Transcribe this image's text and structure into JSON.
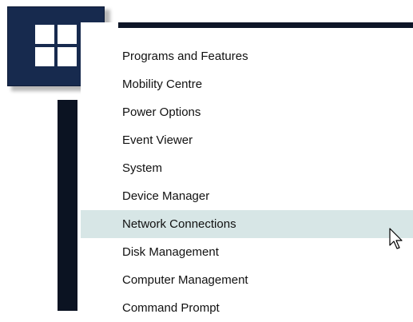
{
  "start_button": {
    "icon": "windows-logo-icon",
    "color": "#172a4e"
  },
  "menu": {
    "highlight_color": "#d7e6e6",
    "items": [
      {
        "label": "Programs and Features",
        "highlighted": false
      },
      {
        "label": "Mobility Centre",
        "highlighted": false
      },
      {
        "label": "Power Options",
        "highlighted": false
      },
      {
        "label": "Event Viewer",
        "highlighted": false
      },
      {
        "label": "System",
        "highlighted": false
      },
      {
        "label": "Device Manager",
        "highlighted": false
      },
      {
        "label": "Network Connections",
        "highlighted": true
      },
      {
        "label": "Disk Management",
        "highlighted": false
      },
      {
        "label": "Computer Management",
        "highlighted": false
      },
      {
        "label": "Command Prompt",
        "highlighted": false
      }
    ]
  },
  "cursor": {
    "icon": "mouse-pointer-icon"
  }
}
